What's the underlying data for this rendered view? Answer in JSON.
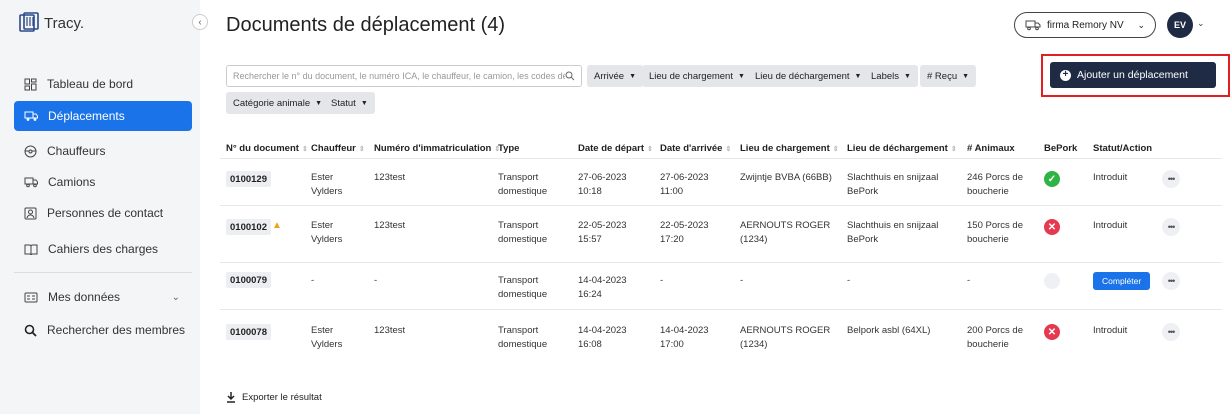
{
  "app": {
    "logo_text": "Tracy."
  },
  "sidebar": {
    "items": [
      {
        "label": "Tableau de bord",
        "icon": "dashboard-icon"
      },
      {
        "label": "Déplacements",
        "icon": "truck-icon",
        "active": true
      },
      {
        "label": "Chauffeurs",
        "icon": "steering-wheel-icon"
      },
      {
        "label": "Camions",
        "icon": "truck-outline-icon"
      },
      {
        "label": "Personnes de contact",
        "icon": "contact-icon"
      },
      {
        "label": "Cahiers des charges",
        "icon": "book-icon"
      },
      {
        "label": "Mes données",
        "icon": "data-icon"
      },
      {
        "label": "Rechercher des membres",
        "icon": "search-icon"
      }
    ]
  },
  "header": {
    "title": "Documents de déplacement (4)",
    "company": "firma Remory NV",
    "avatar_initials": "EV"
  },
  "toolbar": {
    "search_placeholder": "Rechercher le n° du document, le numéro ICA, le chauffeur, le camion, les codes de tri...",
    "filters": [
      "Arrivée",
      "Lieu de chargement",
      "Lieu de déchargement",
      "Labels",
      "# Reçu",
      "Catégorie animale",
      "Statut"
    ],
    "add_button": "Ajouter un déplacement"
  },
  "table": {
    "columns": [
      "N° du document",
      "Chauffeur",
      "Numéro d'immatriculation",
      "Type",
      "Date de départ",
      "Date d'arrivée",
      "Lieu de chargement",
      "Lieu de déchargement",
      "# Animaux",
      "BePork",
      "Statut/Action"
    ],
    "rows": [
      {
        "doc": "0100129",
        "warning": false,
        "driver": "Ester\nVylders",
        "plate": "123test",
        "type": "Transport\ndomestique",
        "depart": "27-06-2023\n10:18",
        "arrival": "27-06-2023\n11:00",
        "loading": "Zwijntje BVBA (66BB)",
        "unloading": "Slachthuis en snijzaal\nBePork",
        "animals": "246 Porcs de\nboucherie",
        "bepork": "ok",
        "status": "Introduit"
      },
      {
        "doc": "0100102",
        "warning": true,
        "driver": "Ester\nVylders",
        "plate": "123test",
        "type": "Transport\ndomestique",
        "depart": "22-05-2023\n15:57",
        "arrival": "22-05-2023\n17:20",
        "loading": "AERNOUTS ROGER\n(1234)",
        "unloading": "Slachthuis en snijzaal\nBePork",
        "animals": "150 Porcs de\nboucherie",
        "bepork": "ko",
        "status": "Introduit"
      },
      {
        "doc": "0100079",
        "warning": false,
        "driver": "-",
        "plate": "-",
        "type": "Transport\ndomestique",
        "depart": "14-04-2023\n16:24",
        "arrival": "-",
        "loading": "-",
        "unloading": "-",
        "animals": "-",
        "bepork": "empty",
        "status": "",
        "action": "Compléter"
      },
      {
        "doc": "0100078",
        "warning": false,
        "driver": "Ester\nVylders",
        "plate": "123test",
        "type": "Transport\ndomestique",
        "depart": "14-04-2023\n16:08",
        "arrival": "14-04-2023\n17:00",
        "loading": "AERNOUTS ROGER\n(1234)",
        "unloading": "Belpork asbl (64XL)",
        "animals": "200 Porcs de\nboucherie",
        "bepork": "ko",
        "status": "Introduit"
      }
    ]
  },
  "footer": {
    "export_label": "Exporter le résultat"
  },
  "colors": {
    "primary": "#1a73e8",
    "dark": "#1f2a44",
    "success": "#2fb344",
    "danger": "#e53950",
    "warning": "#f2a21b",
    "highlight": "#e02020"
  }
}
